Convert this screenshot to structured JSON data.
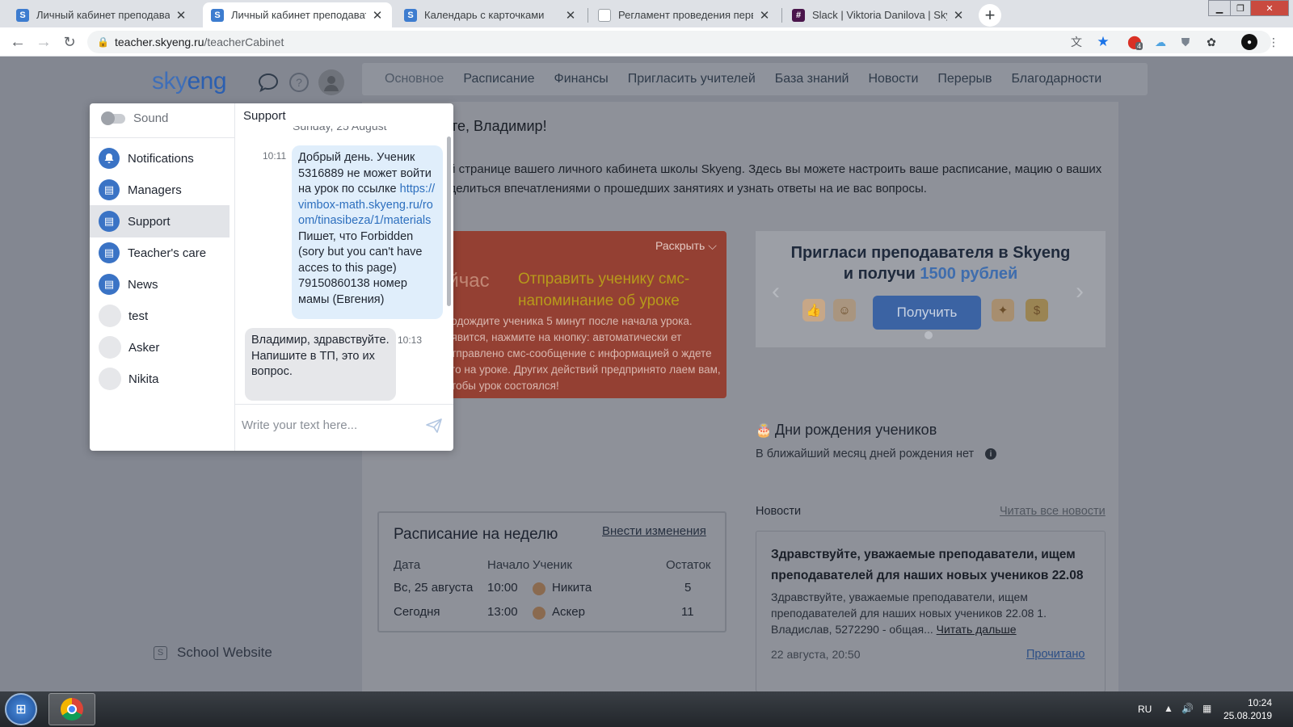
{
  "browser": {
    "tabs": [
      {
        "title": "Личный кабинет преподавателя",
        "favicon": "S",
        "active": false
      },
      {
        "title": "Личный кабинет преподавателя",
        "favicon": "S",
        "active": true
      },
      {
        "title": "Календарь с карточками",
        "favicon": "S",
        "active": false
      },
      {
        "title": "Регламент проведения первого урока",
        "favicon": "doc",
        "active": false
      },
      {
        "title": "Slack | Viktoria Danilova | Skyeng",
        "favicon": "slack",
        "active": false
      }
    ],
    "close_glyph": "✕",
    "new_tab_glyph": "+",
    "url_host": "teacher.skyeng.ru",
    "url_path": "/teacherCabinet",
    "extension_badge": "4"
  },
  "site": {
    "logo_main": "sky",
    "logo_accent": "eng",
    "nav": [
      "Основное",
      "Расписание",
      "Финансы",
      "Пригласить учителей",
      "База знаний",
      "Новости",
      "Перерыв",
      "Благодарности"
    ],
    "greeting": "те, Владимир!",
    "intro": "сь на главной странице вашего личного кабинета школы Skyeng. Здесь вы можете настроить ваше расписание, мацию о ваших учениках, поделиться впечатлениями о прошедших занятиях и узнать ответы на ие вас вопросы.",
    "red_card": {
      "expand_label": "Раскрыть",
      "now_label": "ейчас",
      "sms_action": "Отправить ученику смс-напоминание об уроке",
      "description": "подождите ученика 5 минут после начала урока. оявится, нажмите на кнопку: автоматически ет отправлено смс-сообщение с информацией о ждете его на уроке. Других действий предпринято лаем вам, чтобы урок состоялся!"
    },
    "banner": {
      "line1": "Пригласи преподавателя в Skyeng",
      "line2_prefix": "и получи ",
      "line2_accent": "1500 рублей",
      "button": "Получить"
    },
    "birthdays": {
      "title": "Дни рождения учеников",
      "text": "В ближайший месяц дней рождения нет"
    },
    "schedule": {
      "title": "Расписание на неделю",
      "edit_link": "Внести изменения",
      "headers": [
        "Дата",
        "Начало",
        "Ученик",
        "Остаток"
      ],
      "rows": [
        {
          "date": "Вс, 25 августа",
          "start": "10:00",
          "student": "Никита",
          "remaining": "5"
        },
        {
          "date": "Сегодня",
          "start": "13:00",
          "student": "Аскер",
          "remaining": "11"
        }
      ]
    },
    "news": {
      "heading": "Новости",
      "read_all": "Читать все новости",
      "item_title": "Здравствуйте, уважаемые преподаватели, ищем преподавателей для наших новых учеников 22.08",
      "item_body": "Здравствуйте, уважаемые преподаватели, ищем преподавателей для наших новых учеников 22.08 1. Владислав, 5272290 - общая...",
      "read_more": "Читать дальше",
      "date": "22 августа, 20:50",
      "status": "Прочитано"
    },
    "school_site": "School Website"
  },
  "chat": {
    "sound_label": "Sound",
    "channels": [
      {
        "label": "Notifications",
        "icon": "bell-icon",
        "selected": false
      },
      {
        "label": "Managers",
        "icon": "channel-icon",
        "selected": false
      },
      {
        "label": "Support",
        "icon": "channel-icon",
        "selected": true
      },
      {
        "label": "Teacher's care",
        "icon": "channel-icon",
        "selected": false
      },
      {
        "label": "News",
        "icon": "channel-icon",
        "selected": false
      },
      {
        "label": "test",
        "icon": "avatar",
        "selected": false
      },
      {
        "label": "Asker",
        "icon": "avatar",
        "selected": false
      },
      {
        "label": "Nikita",
        "icon": "avatar",
        "selected": false
      }
    ],
    "header": "Support",
    "day": "Sunday, 25 August",
    "messages": [
      {
        "time": "10:11",
        "text_before": "Добрый день. Ученик 5316889 не может войти на урок по ссылке ",
        "link": "https://vimbox-math.skyeng.ru/room/tinasibeza/1/materials",
        "text_after": " Пишет, что Forbidden (sory but you can't have acces to this page) 79150860138 номер мамы (Евгения)"
      },
      {
        "time": "10:13",
        "text": "Владимир, здравствуйте. Напишите в ТП, это их вопрос."
      }
    ],
    "input_placeholder": "Write your text here..."
  },
  "taskbar": {
    "lang": "RU",
    "time": "10:24",
    "date": "25.08.2019"
  }
}
